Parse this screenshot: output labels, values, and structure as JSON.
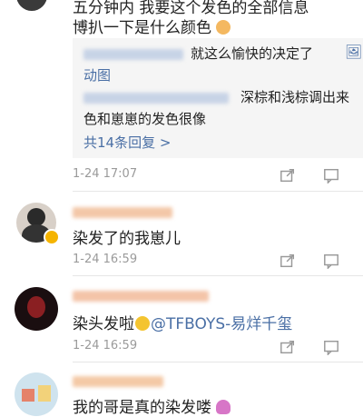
{
  "top_comment": {
    "text_line1": "五分钟内 我要这个发色的全部信息",
    "text_line2": "博扒一下是什么颜色",
    "time": "1-24 17:07",
    "replies": [
      {
        "text": "就这么愉快的决定了"
      },
      {
        "text_line1": "深棕和浅棕调出来",
        "text_line2": "色和崽崽的发色很像"
      }
    ],
    "more_replies": "共14条回复 >"
  },
  "comments": [
    {
      "text": "染发了的我崽儿",
      "time": "1-24 16:59"
    },
    {
      "text": "染头发啦",
      "mention": "@TFBOYS-易烊千玺",
      "time": "1-24 16:59"
    },
    {
      "text": "我的哥是真的染发喽"
    }
  ],
  "icons": {
    "share": "share-icon",
    "comment": "comment-icon",
    "picture": "picture-icon",
    "emoji": "emoji-icon"
  },
  "colors": {
    "link": "#4a6fa5",
    "meta": "#9a9a9a",
    "reply_bg": "#f5f5f5"
  }
}
